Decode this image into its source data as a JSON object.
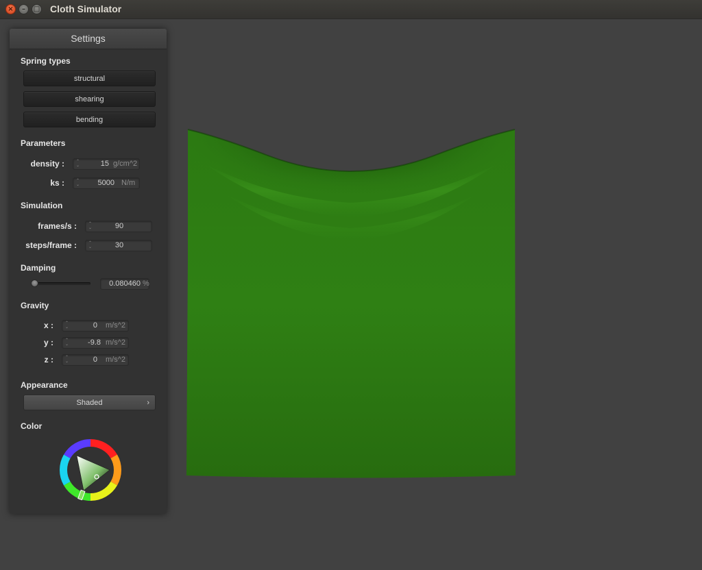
{
  "window": {
    "title": "Cloth Simulator",
    "close_glyph": "×",
    "min_glyph": "–",
    "max_glyph": "□"
  },
  "panel": {
    "title": "Settings",
    "spring_types": {
      "label": "Spring types",
      "buttons": [
        "structural",
        "shearing",
        "bending"
      ]
    },
    "parameters": {
      "label": "Parameters",
      "density": {
        "label": "density :",
        "value": "15",
        "unit": "g/cm^2"
      },
      "ks": {
        "label": "ks :",
        "value": "5000",
        "unit": "N/m"
      }
    },
    "simulation": {
      "label": "Simulation",
      "frames": {
        "label": "frames/s :",
        "value": "90"
      },
      "steps": {
        "label": "steps/frame :",
        "value": "30"
      }
    },
    "damping": {
      "label": "Damping",
      "value": "0.080460",
      "unit": "%",
      "slider_fraction": 0.0
    },
    "gravity": {
      "label": "Gravity",
      "x": {
        "label": "x :",
        "value": "0",
        "unit": "m/s^2"
      },
      "y": {
        "label": "y :",
        "value": "-9.8",
        "unit": "m/s^2"
      },
      "z": {
        "label": "z :",
        "value": "0",
        "unit": "m/s^2"
      }
    },
    "appearance": {
      "label": "Appearance",
      "value": "Shaded",
      "chevron": "›"
    },
    "color": {
      "label": "Color",
      "selected_hex": "#2f7f12"
    }
  },
  "colors": {
    "background": "#414141",
    "cloth": "#2f7f12",
    "panel": "#323232"
  }
}
